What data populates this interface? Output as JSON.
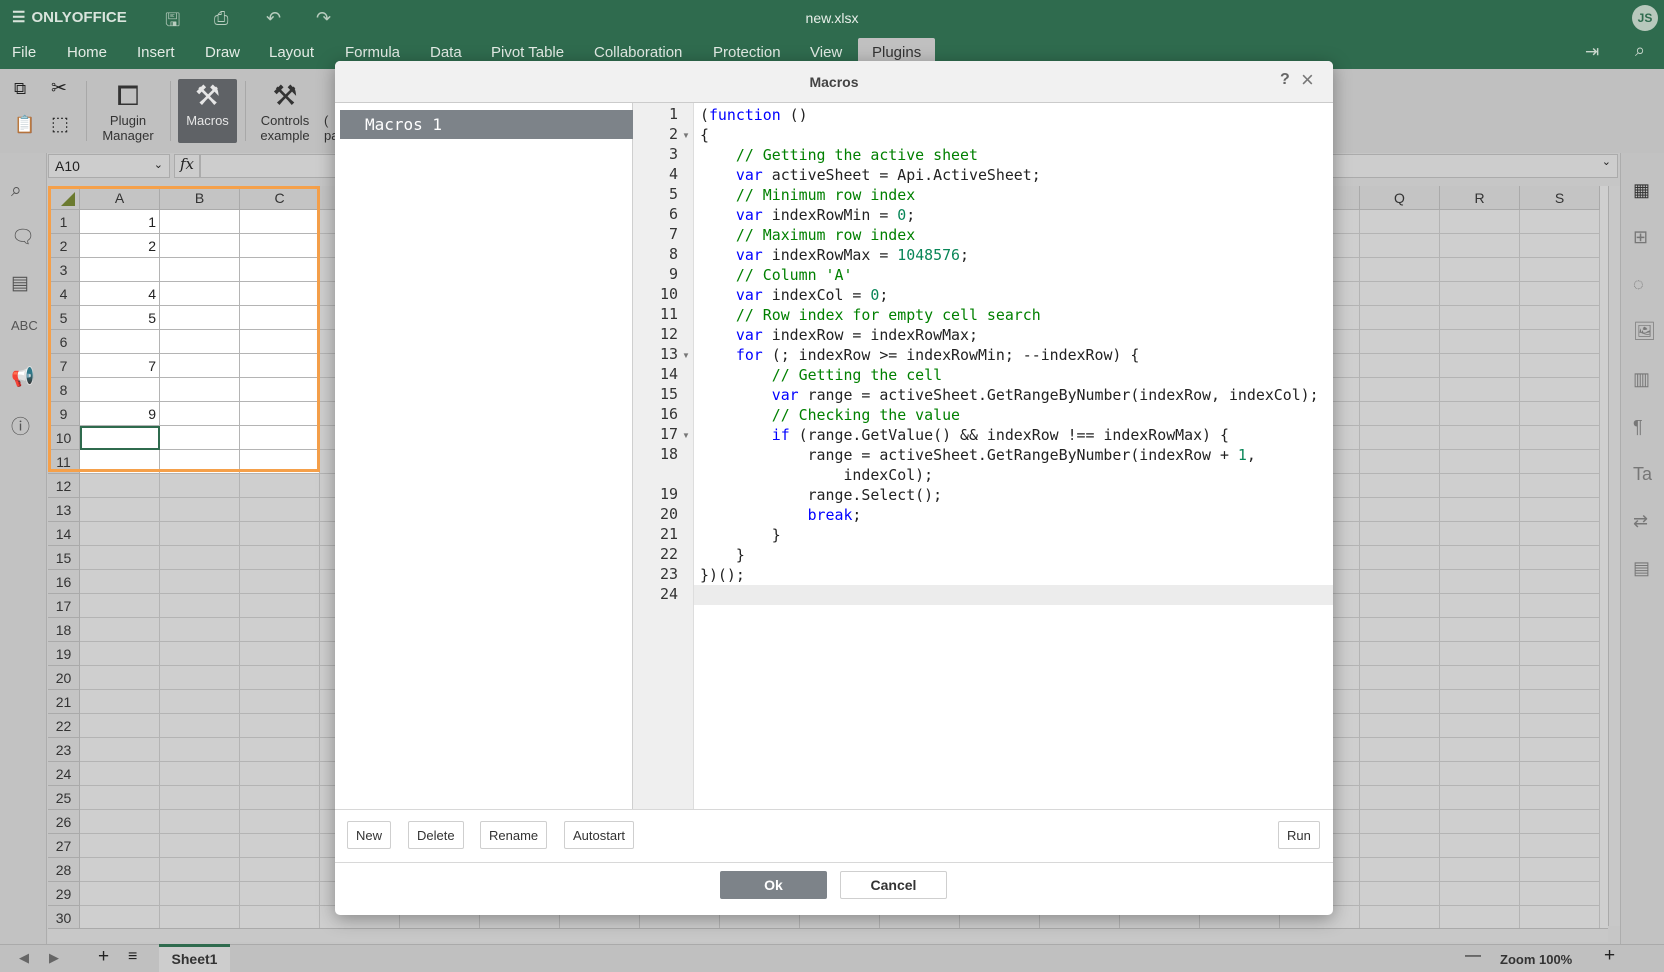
{
  "app": {
    "brand": "ONLYOFFICE",
    "doc_title": "new.xlsx",
    "user_initials": "JS",
    "accent": "#2f6b4e"
  },
  "quick_access": [
    {
      "icon": "save-icon",
      "glyph": "🖫"
    },
    {
      "icon": "print-icon",
      "glyph": "⎙"
    },
    {
      "icon": "undo-icon",
      "glyph": "↶"
    },
    {
      "icon": "redo-icon",
      "glyph": "↷"
    }
  ],
  "menu": [
    "File",
    "Home",
    "Insert",
    "Draw",
    "Layout",
    "Formula",
    "Data",
    "Pivot Table",
    "Collaboration",
    "Protection",
    "View",
    "Plugins"
  ],
  "menu_active": "Plugins",
  "toolbar": {
    "plugin_manager": [
      "Plugin",
      "Manager"
    ],
    "macros": "Macros",
    "controls": [
      "Controls",
      "example"
    ],
    "partial": [
      "(",
      "pa"
    ]
  },
  "formula": {
    "name_box": "A10",
    "fx": "fx",
    "value": ""
  },
  "grid": {
    "columns_left": [
      "A",
      "B",
      "C"
    ],
    "columns_right": [
      "Q",
      "R",
      "S"
    ],
    "rows": [
      "1",
      "2",
      "3",
      "4",
      "5",
      "6",
      "7",
      "8",
      "9",
      "10",
      "11",
      "12",
      "13",
      "14",
      "15",
      "16",
      "17",
      "18",
      "19",
      "20",
      "21",
      "22",
      "23",
      "24",
      "25",
      "26",
      "27",
      "28",
      "29",
      "30"
    ],
    "colA": [
      "1",
      "2",
      "",
      "4",
      "5",
      "",
      "7",
      "",
      "9",
      "",
      ""
    ],
    "active_cell": "A10",
    "highlight_color": "#f5a04a"
  },
  "sheets": {
    "tabs": [
      "Sheet1"
    ],
    "zoom": "Zoom 100%"
  },
  "dialog": {
    "title": "Macros",
    "help": "?",
    "close": "×",
    "macros": [
      "Macros 1"
    ],
    "code": [
      "(function ()",
      "{",
      "    // Getting the active sheet",
      "    var activeSheet = Api.ActiveSheet;",
      "    // Minimum row index",
      "    var indexRowMin = 0;",
      "    // Maximum row index",
      "    var indexRowMax = 1048576;",
      "    // Column 'A'",
      "    var indexCol = 0;",
      "    // Row index for empty cell search",
      "    var indexRow = indexRowMax;",
      "    for (; indexRow >= indexRowMin; --indexRow) {",
      "        // Getting the cell",
      "        var range = activeSheet.GetRangeByNumber(indexRow, indexCol);",
      "        // Checking the value",
      "        if (range.GetValue() && indexRow !== indexRowMax) {",
      "            range = activeSheet.GetRangeByNumber(indexRow + 1, indexCol);",
      "            range.Select();",
      "            break;",
      "        }",
      "    }",
      "})();",
      ""
    ],
    "fold_lines": [
      2,
      13,
      17
    ],
    "buttons": {
      "new": "New",
      "delete": "Delete",
      "rename": "Rename",
      "autostart": "Autostart",
      "run": "Run",
      "ok": "Ok",
      "cancel": "Cancel"
    }
  }
}
